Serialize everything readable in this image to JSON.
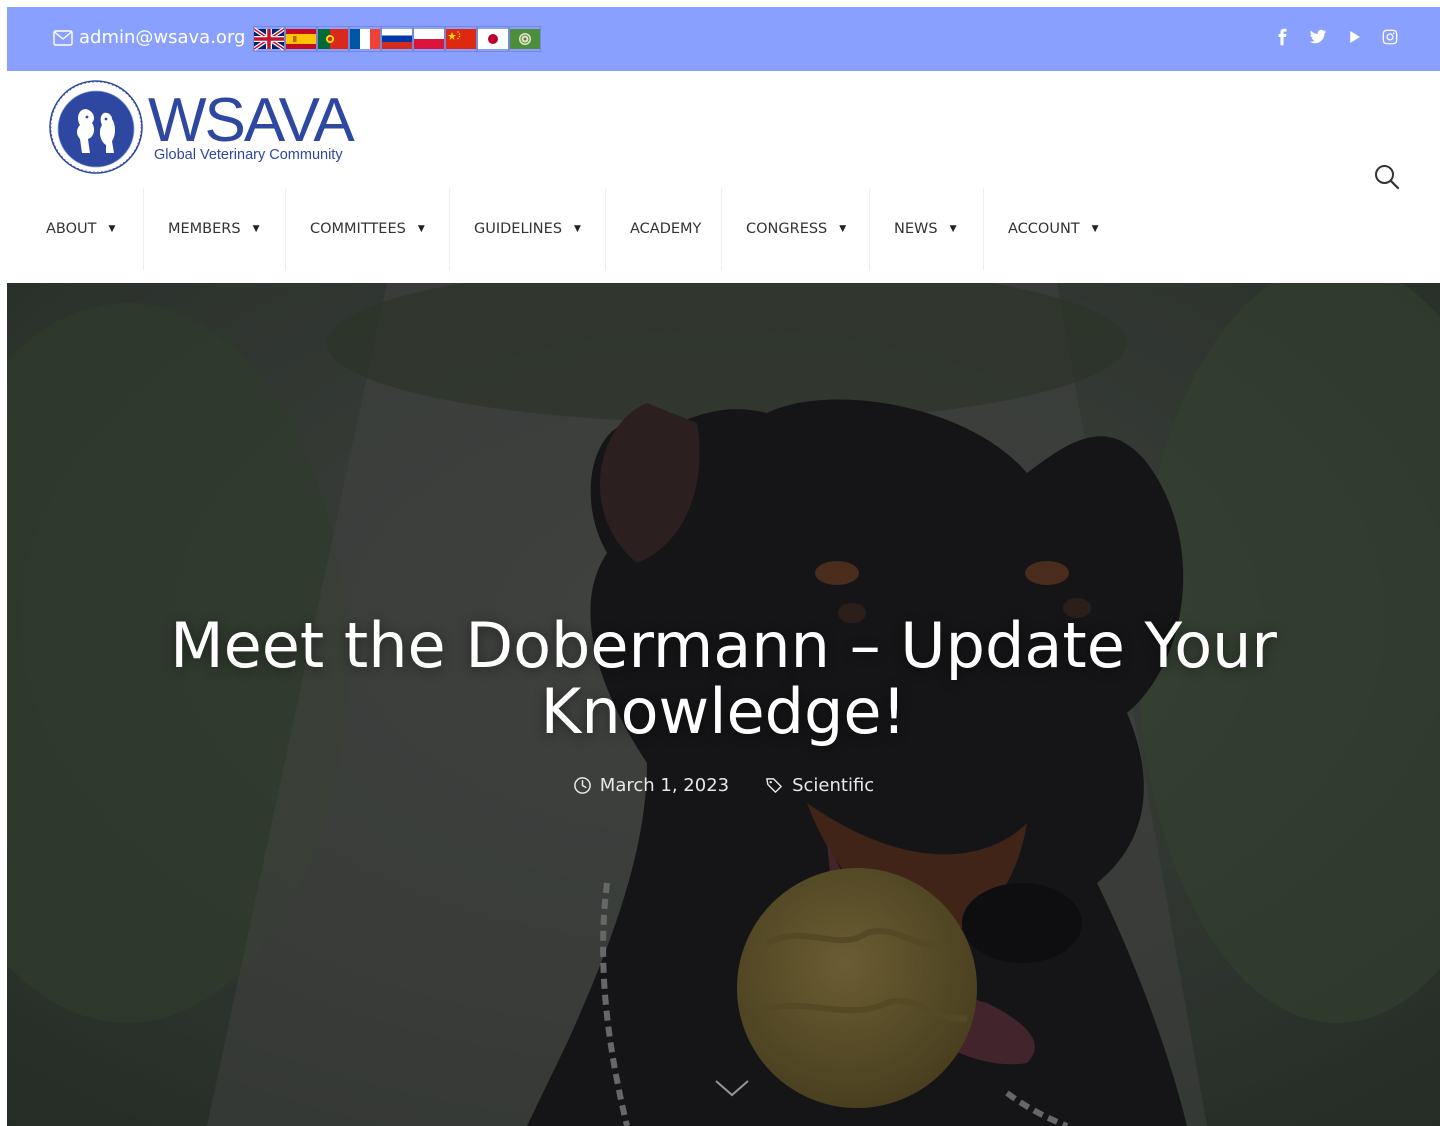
{
  "topbar": {
    "email": "admin@wsava.org",
    "flags": [
      "English",
      "Spanish",
      "Portuguese",
      "French",
      "Russian",
      "Polish",
      "Chinese",
      "Japanese",
      "Arabic"
    ],
    "social": [
      "facebook-icon",
      "twitter-icon",
      "youtube-icon",
      "instagram-icon"
    ],
    "background": "#8aa0ff"
  },
  "header": {
    "logo_word": "WSAVA",
    "logo_tagline": "Global Veterinary Community",
    "brand_color": "#2e47a1"
  },
  "nav": {
    "items": [
      {
        "label": "ABOUT",
        "has_dropdown": true
      },
      {
        "label": "MEMBERS",
        "has_dropdown": true
      },
      {
        "label": "COMMITTEES",
        "has_dropdown": true
      },
      {
        "label": "GUIDELINES",
        "has_dropdown": true
      },
      {
        "label": "ACADEMY",
        "has_dropdown": false
      },
      {
        "label": "CONGRESS",
        "has_dropdown": true
      },
      {
        "label": "NEWS",
        "has_dropdown": true
      },
      {
        "label": "ACCOUNT",
        "has_dropdown": true
      }
    ]
  },
  "hero": {
    "title": "Meet the Dobermann – Update Your Knowledge!",
    "date": "March 1, 2023",
    "category": "Scientific"
  }
}
